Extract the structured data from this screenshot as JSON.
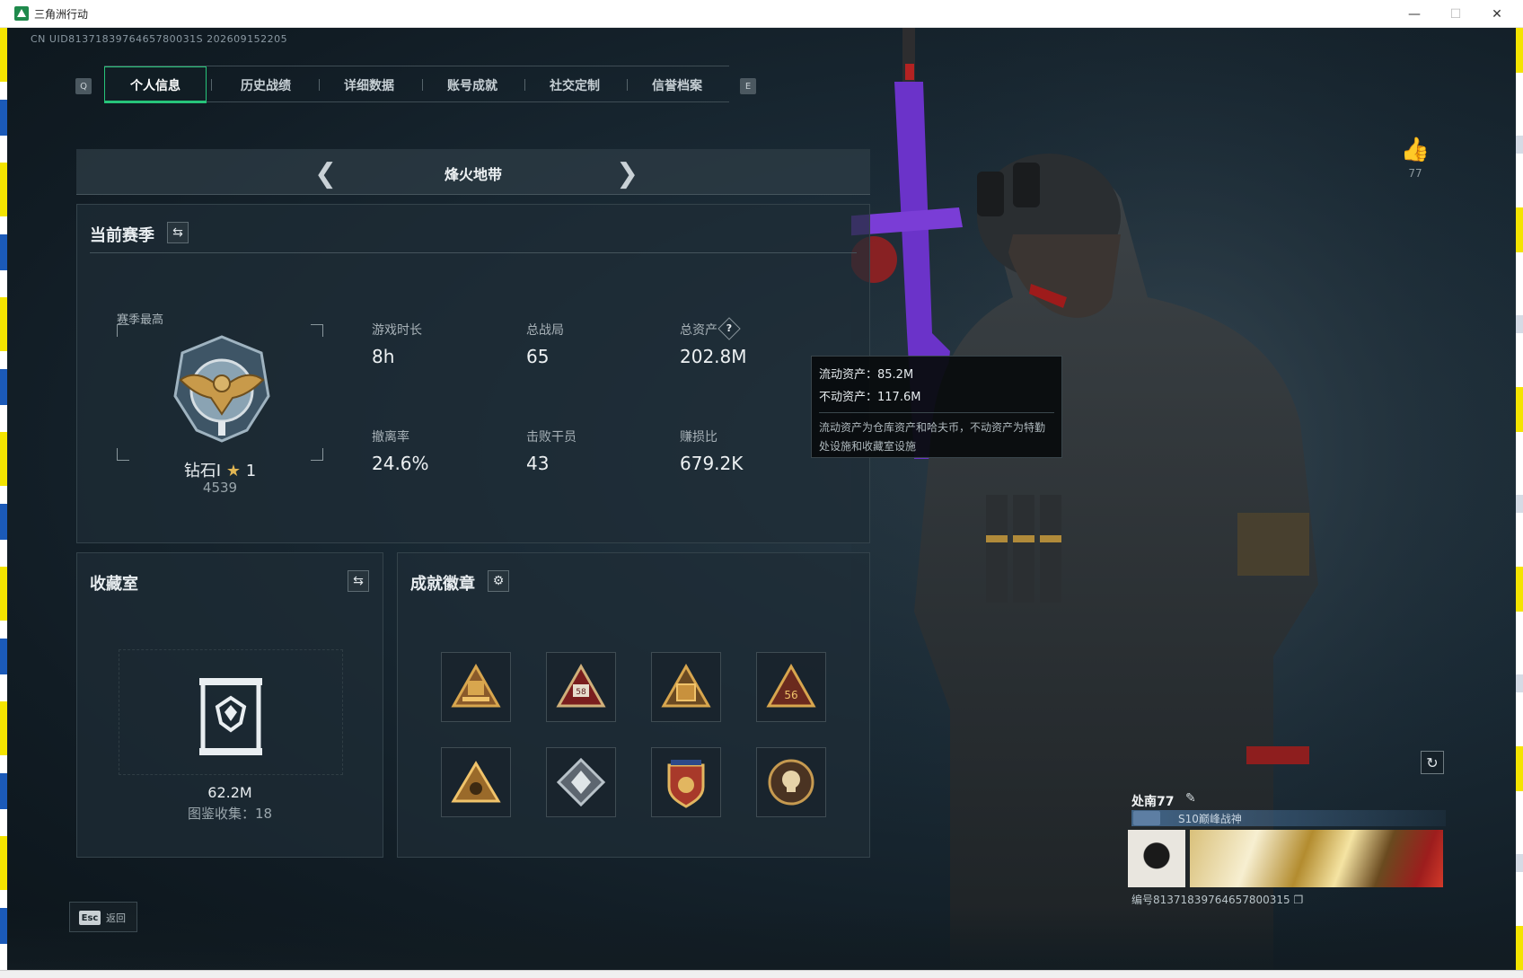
{
  "window": {
    "title": "三角洲行动",
    "minimize": "—",
    "maximize": "☐",
    "close": "✕"
  },
  "uid_text": "CN UID8137183976465780031S 202609152205",
  "tabs": {
    "q_key": "Q",
    "e_key": "E",
    "items": [
      "个人信息",
      "历史战绩",
      "详细数据",
      "账号成就",
      "社交定制",
      "信誉档案"
    ],
    "active_index": 0
  },
  "map_selector": {
    "name": "烽火地带",
    "prev_icon": "chevron-left-icon",
    "next_icon": "chevron-right-icon"
  },
  "season": {
    "title": "当前赛季",
    "best_label": "赛季最高",
    "rank_name": "钻石I",
    "rank_star": "★",
    "rank_stars": "1",
    "rank_score": "4539",
    "stats": [
      {
        "label": "游戏时长",
        "value": "8h"
      },
      {
        "label": "总战局",
        "value": "65"
      },
      {
        "label": "总资产",
        "value": "202.8M"
      },
      {
        "label": "撤离率",
        "value": "24.6%"
      },
      {
        "label": "击败干员",
        "value": "43"
      },
      {
        "label": "赚损比",
        "value": "679.2K"
      }
    ],
    "help_glyph": "?"
  },
  "tooltip": {
    "line1": "流动资产：85.2M",
    "line2": "不动资产：117.6M",
    "description": "流动资产为仓库资产和哈夫币，不动资产为特勤处设施和收藏室设施"
  },
  "collection": {
    "title": "收藏室",
    "value": "62.2M",
    "count_text": "图鉴收集：18"
  },
  "badges": {
    "title": "成就徽章",
    "items": [
      {
        "icon": "badge-tier-gold-icon"
      },
      {
        "icon": "badge-58-icon",
        "text": "58"
      },
      {
        "icon": "badge-triangle-crate-icon"
      },
      {
        "icon": "badge-56-icon",
        "text": "56"
      },
      {
        "icon": "badge-triangle-eye-icon"
      },
      {
        "icon": "badge-diamond-icon"
      },
      {
        "icon": "badge-shield-stars-icon"
      },
      {
        "icon": "badge-skull-icon"
      }
    ]
  },
  "profile": {
    "likes": "77",
    "player_name": "处南77",
    "player_title": "S10巅峰战神",
    "serial": "编号81371839764657800315"
  },
  "footer": {
    "esc_key": "Esc",
    "back_label": "返回"
  },
  "colors": {
    "accent": "#27c47a",
    "gold": "#e1b653",
    "background": "#15222b"
  }
}
